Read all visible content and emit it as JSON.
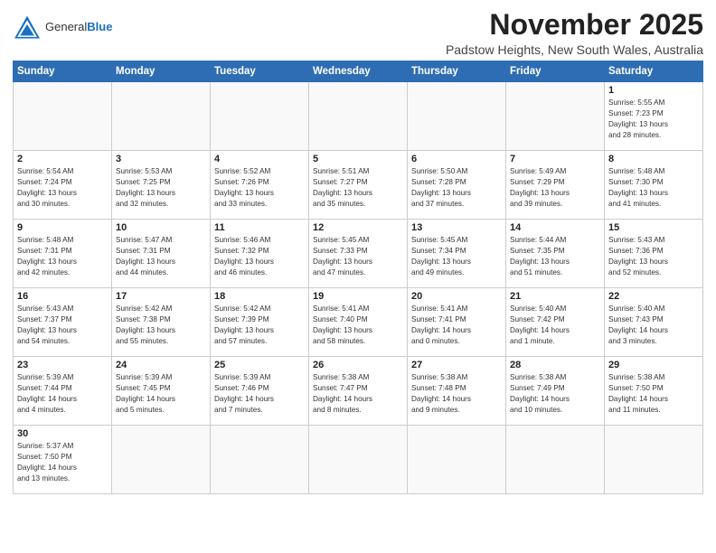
{
  "header": {
    "logo_general": "General",
    "logo_blue": "Blue",
    "month_title": "November 2025",
    "subtitle": "Padstow Heights, New South Wales, Australia"
  },
  "days_of_week": [
    "Sunday",
    "Monday",
    "Tuesday",
    "Wednesday",
    "Thursday",
    "Friday",
    "Saturday"
  ],
  "weeks": [
    [
      {
        "day": "",
        "info": ""
      },
      {
        "day": "",
        "info": ""
      },
      {
        "day": "",
        "info": ""
      },
      {
        "day": "",
        "info": ""
      },
      {
        "day": "",
        "info": ""
      },
      {
        "day": "",
        "info": ""
      },
      {
        "day": "1",
        "info": "Sunrise: 5:55 AM\nSunset: 7:23 PM\nDaylight: 13 hours\nand 28 minutes."
      }
    ],
    [
      {
        "day": "2",
        "info": "Sunrise: 5:54 AM\nSunset: 7:24 PM\nDaylight: 13 hours\nand 30 minutes."
      },
      {
        "day": "3",
        "info": "Sunrise: 5:53 AM\nSunset: 7:25 PM\nDaylight: 13 hours\nand 32 minutes."
      },
      {
        "day": "4",
        "info": "Sunrise: 5:52 AM\nSunset: 7:26 PM\nDaylight: 13 hours\nand 33 minutes."
      },
      {
        "day": "5",
        "info": "Sunrise: 5:51 AM\nSunset: 7:27 PM\nDaylight: 13 hours\nand 35 minutes."
      },
      {
        "day": "6",
        "info": "Sunrise: 5:50 AM\nSunset: 7:28 PM\nDaylight: 13 hours\nand 37 minutes."
      },
      {
        "day": "7",
        "info": "Sunrise: 5:49 AM\nSunset: 7:29 PM\nDaylight: 13 hours\nand 39 minutes."
      },
      {
        "day": "8",
        "info": "Sunrise: 5:48 AM\nSunset: 7:30 PM\nDaylight: 13 hours\nand 41 minutes."
      }
    ],
    [
      {
        "day": "9",
        "info": "Sunrise: 5:48 AM\nSunset: 7:31 PM\nDaylight: 13 hours\nand 42 minutes."
      },
      {
        "day": "10",
        "info": "Sunrise: 5:47 AM\nSunset: 7:31 PM\nDaylight: 13 hours\nand 44 minutes."
      },
      {
        "day": "11",
        "info": "Sunrise: 5:46 AM\nSunset: 7:32 PM\nDaylight: 13 hours\nand 46 minutes."
      },
      {
        "day": "12",
        "info": "Sunrise: 5:45 AM\nSunset: 7:33 PM\nDaylight: 13 hours\nand 47 minutes."
      },
      {
        "day": "13",
        "info": "Sunrise: 5:45 AM\nSunset: 7:34 PM\nDaylight: 13 hours\nand 49 minutes."
      },
      {
        "day": "14",
        "info": "Sunrise: 5:44 AM\nSunset: 7:35 PM\nDaylight: 13 hours\nand 51 minutes."
      },
      {
        "day": "15",
        "info": "Sunrise: 5:43 AM\nSunset: 7:36 PM\nDaylight: 13 hours\nand 52 minutes."
      }
    ],
    [
      {
        "day": "16",
        "info": "Sunrise: 5:43 AM\nSunset: 7:37 PM\nDaylight: 13 hours\nand 54 minutes."
      },
      {
        "day": "17",
        "info": "Sunrise: 5:42 AM\nSunset: 7:38 PM\nDaylight: 13 hours\nand 55 minutes."
      },
      {
        "day": "18",
        "info": "Sunrise: 5:42 AM\nSunset: 7:39 PM\nDaylight: 13 hours\nand 57 minutes."
      },
      {
        "day": "19",
        "info": "Sunrise: 5:41 AM\nSunset: 7:40 PM\nDaylight: 13 hours\nand 58 minutes."
      },
      {
        "day": "20",
        "info": "Sunrise: 5:41 AM\nSunset: 7:41 PM\nDaylight: 14 hours\nand 0 minutes."
      },
      {
        "day": "21",
        "info": "Sunrise: 5:40 AM\nSunset: 7:42 PM\nDaylight: 14 hours\nand 1 minute."
      },
      {
        "day": "22",
        "info": "Sunrise: 5:40 AM\nSunset: 7:43 PM\nDaylight: 14 hours\nand 3 minutes."
      }
    ],
    [
      {
        "day": "23",
        "info": "Sunrise: 5:39 AM\nSunset: 7:44 PM\nDaylight: 14 hours\nand 4 minutes."
      },
      {
        "day": "24",
        "info": "Sunrise: 5:39 AM\nSunset: 7:45 PM\nDaylight: 14 hours\nand 5 minutes."
      },
      {
        "day": "25",
        "info": "Sunrise: 5:39 AM\nSunset: 7:46 PM\nDaylight: 14 hours\nand 7 minutes."
      },
      {
        "day": "26",
        "info": "Sunrise: 5:38 AM\nSunset: 7:47 PM\nDaylight: 14 hours\nand 8 minutes."
      },
      {
        "day": "27",
        "info": "Sunrise: 5:38 AM\nSunset: 7:48 PM\nDaylight: 14 hours\nand 9 minutes."
      },
      {
        "day": "28",
        "info": "Sunrise: 5:38 AM\nSunset: 7:49 PM\nDaylight: 14 hours\nand 10 minutes."
      },
      {
        "day": "29",
        "info": "Sunrise: 5:38 AM\nSunset: 7:50 PM\nDaylight: 14 hours\nand 11 minutes."
      }
    ],
    [
      {
        "day": "30",
        "info": "Sunrise: 5:37 AM\nSunset: 7:50 PM\nDaylight: 14 hours\nand 13 minutes."
      },
      {
        "day": "",
        "info": ""
      },
      {
        "day": "",
        "info": ""
      },
      {
        "day": "",
        "info": ""
      },
      {
        "day": "",
        "info": ""
      },
      {
        "day": "",
        "info": ""
      },
      {
        "day": "",
        "info": ""
      }
    ]
  ]
}
